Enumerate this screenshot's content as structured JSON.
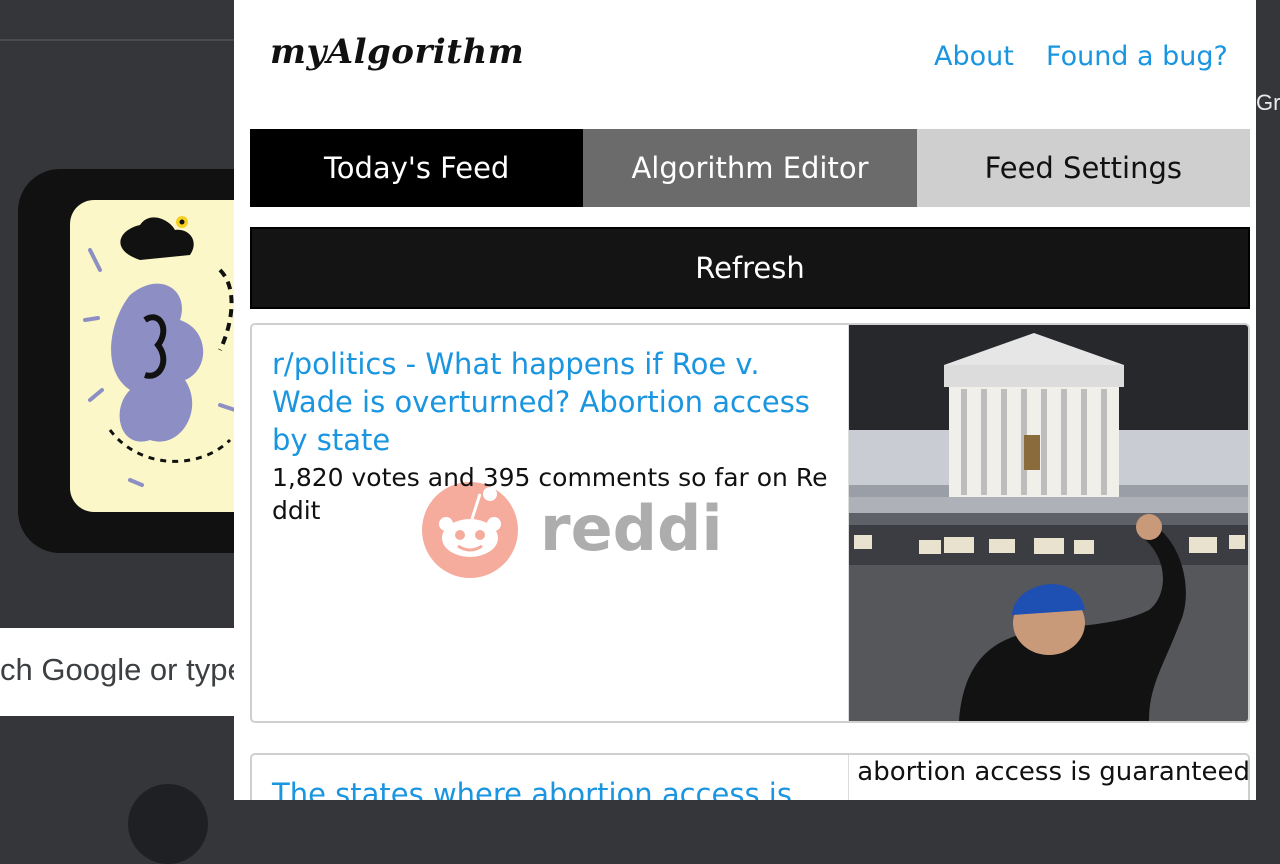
{
  "background": {
    "search_placeholder": "ch Google or type",
    "right_edge_text": "Gr"
  },
  "header": {
    "brand": "myAlgorithm",
    "links": [
      "About",
      "Found a bug?"
    ]
  },
  "tabs": [
    {
      "label": "Today's Feed",
      "active": true
    },
    {
      "label": "Algorithm Editor",
      "active": false
    },
    {
      "label": "Feed Settings",
      "active": false
    }
  ],
  "refresh_label": "Refresh",
  "feed": [
    {
      "title": "r/politics - What happens if Roe v. Wade is overturned? Abortion access by state",
      "subtitle": "1,820 votes and 395 comments so far on Reddit",
      "source": "reddit",
      "image": "supreme-court-night-protest"
    },
    {
      "title": "The states where abortion access is guaranteed",
      "image_alt": "The states where abortion access is guaranteed"
    }
  ],
  "colors": {
    "link": "#1a95e0",
    "tab_active": "#000000",
    "tab_editor": "#6b6b6b",
    "tab_settings": "#cfcfcf",
    "reddit_logo": "#f5a898",
    "reddit_word": "#a9a9a9"
  }
}
